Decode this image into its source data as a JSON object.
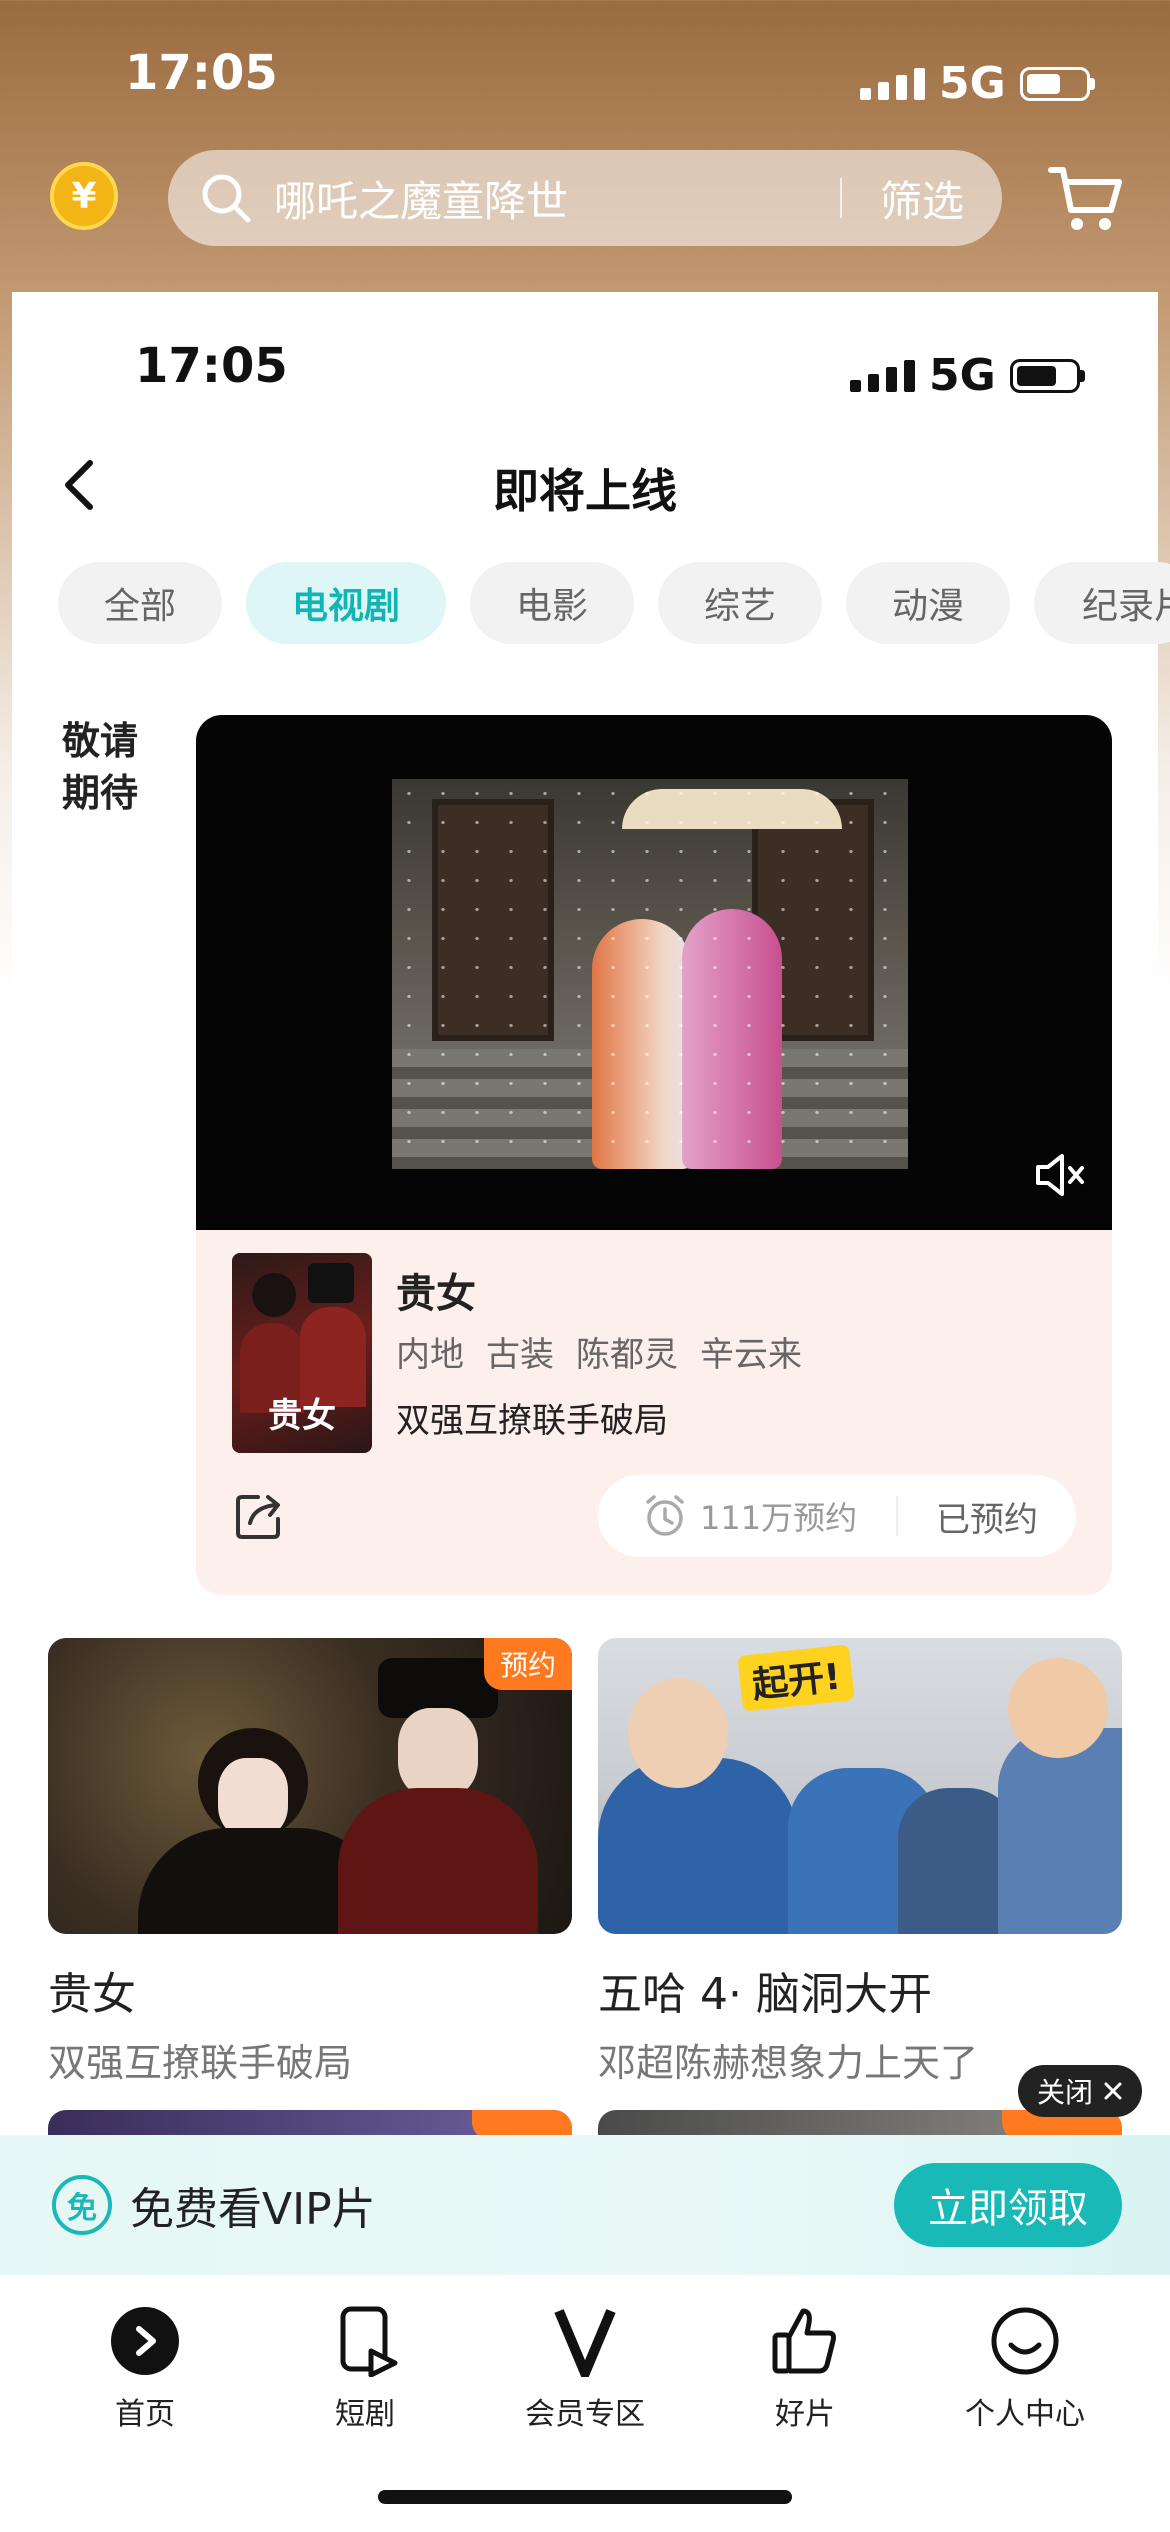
{
  "status_outer": {
    "time": "17:05",
    "network": "5G"
  },
  "status_inner": {
    "time": "17:05",
    "network": "5G"
  },
  "topbar": {
    "coin_symbol": "¥",
    "search_placeholder": "哪吒之魔童降世",
    "filter_label": "筛选"
  },
  "page": {
    "title": "即将上线"
  },
  "tabs": [
    {
      "label": "全部",
      "active": false
    },
    {
      "label": "电视剧",
      "active": true
    },
    {
      "label": "电影",
      "active": false
    },
    {
      "label": "综艺",
      "active": false
    },
    {
      "label": "动漫",
      "active": false
    },
    {
      "label": "纪录片",
      "active": false
    }
  ],
  "section": {
    "label_line1": "敬请",
    "label_line2": "期待"
  },
  "featured": {
    "poster_text": "贵女",
    "title": "贵女",
    "tags": [
      "内地",
      "古装",
      "陈都灵",
      "辛云来"
    ],
    "desc": "双强互撩联手破局",
    "reserve_count": "111万预约",
    "reserve_status": "已预约"
  },
  "cards": [
    {
      "badge": "预约",
      "title": "贵女",
      "subtitle": "双强互撩联手破局",
      "banner_text": ""
    },
    {
      "badge": "",
      "title": "五哈 4· 脑洞大开",
      "subtitle": "邓超陈赫想象力上天了",
      "banner_text": "起开!"
    }
  ],
  "close_popup": {
    "label": "关闭"
  },
  "vip_banner": {
    "icon_char": "免",
    "text": "免费看VIP片",
    "button": "立即领取"
  },
  "bottom_nav": [
    {
      "label": "首页",
      "icon": "play-circle-icon"
    },
    {
      "label": "短剧",
      "icon": "short-drama-icon"
    },
    {
      "label": "会员专区",
      "icon": "vip-v-icon"
    },
    {
      "label": "好片",
      "icon": "thumbs-up-icon"
    },
    {
      "label": "个人中心",
      "icon": "smile-face-icon"
    }
  ],
  "colors": {
    "accent": "#19b9b8",
    "badge": "#ff7a1e",
    "feature_bg": "#fdf0ec"
  }
}
